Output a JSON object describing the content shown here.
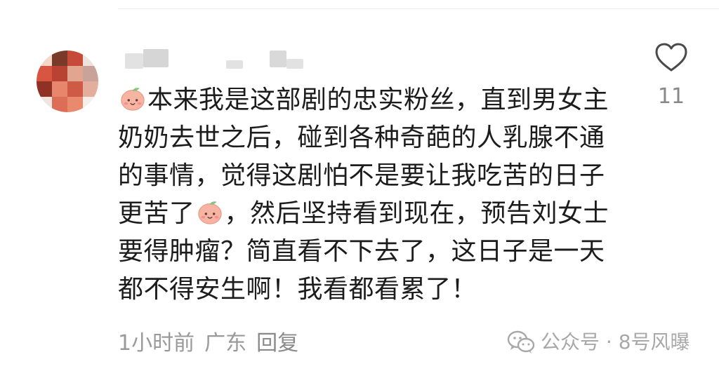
{
  "comment": {
    "segments": [
      "本来我是这部剧的忠实粉丝，直到男女主奶奶去世之后，碰到各种奇葩的人乳腺不通的事情，觉得这剧怕不是要让我吃苦的日子更苦了",
      "，然后坚持看到现在，预告刘女士要得肿瘤？简直看不下去了，这日子是一天都不得安生啊！我看都看累了！"
    ],
    "emoji_icon": "peach-face-emoji-icon"
  },
  "like": {
    "count": "11",
    "icon": "heart-outline-icon"
  },
  "meta": {
    "time": "1小时前",
    "location": "广东",
    "reply_label": "回复"
  },
  "watermark": {
    "icon": "wechat-icon",
    "text": "公众号 · 8号风曝"
  },
  "colors": {
    "text": "#1c1c1c",
    "meta": "#9a9a9a",
    "watermark": "#a8a8a8"
  }
}
